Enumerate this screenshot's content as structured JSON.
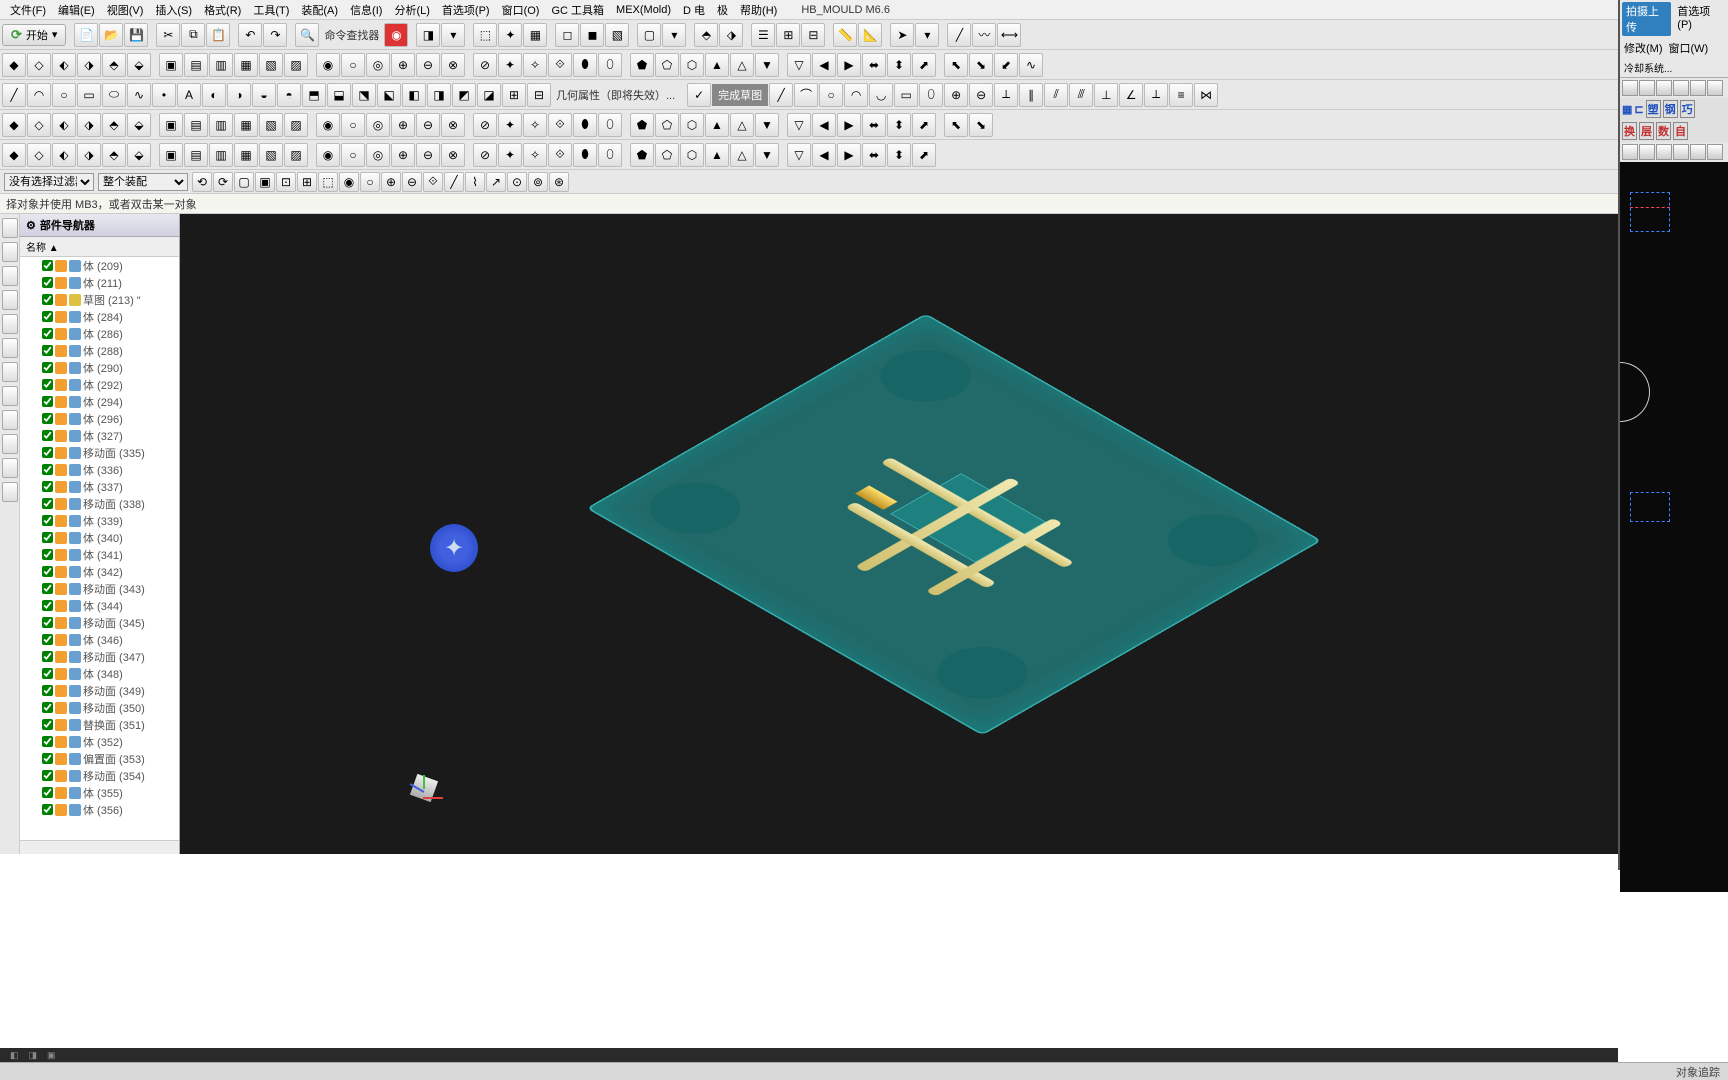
{
  "menubar": {
    "items": [
      "文件(F)",
      "编辑(E)",
      "视图(V)",
      "插入(S)",
      "格式(R)",
      "工具(T)",
      "装配(A)",
      "信息(I)",
      "分析(L)",
      "首选项(P)",
      "窗口(O)",
      "GC 工具箱",
      "MEX(Mold)",
      "D 电",
      "极",
      "帮助(H)"
    ],
    "title": "HB_MOULD M6.6"
  },
  "right_top": {
    "upload": "拍摄上传",
    "pref": "首选项(P)"
  },
  "right_menu": {
    "m1": "修改(M)",
    "m2": "窗口(W)"
  },
  "right_tab": "冷却系统...",
  "right_band": [
    "塑",
    "钢",
    "巧"
  ],
  "right_band2": [
    "换",
    "层",
    "数",
    "自"
  ],
  "start_btn": {
    "label": "开始"
  },
  "cmd_finder": "命令查找器",
  "geom_prop": "几何属性（即将失效）...",
  "complete_sketch": "完成草图",
  "selection": {
    "filter_label": "有选择过滤器",
    "filter_value": "没有选择过滤器",
    "scope_value": "整个装配"
  },
  "prompt": "择对象并使用 MB3，或者双击某一对象",
  "nav": {
    "title": "部件导航器",
    "col": "名称 ▲",
    "items": [
      {
        "t": "体",
        "n": "(209)"
      },
      {
        "t": "体",
        "n": "(211)"
      },
      {
        "t": "草图",
        "n": "(213) \"",
        "sketch": true
      },
      {
        "t": "体",
        "n": "(284)"
      },
      {
        "t": "体",
        "n": "(286)"
      },
      {
        "t": "体",
        "n": "(288)"
      },
      {
        "t": "体",
        "n": "(290)"
      },
      {
        "t": "体",
        "n": "(292)"
      },
      {
        "t": "体",
        "n": "(294)"
      },
      {
        "t": "体",
        "n": "(296)"
      },
      {
        "t": "体",
        "n": "(327)"
      },
      {
        "t": "移动面",
        "n": "(335)"
      },
      {
        "t": "体",
        "n": "(336)"
      },
      {
        "t": "体",
        "n": "(337)"
      },
      {
        "t": "移动面",
        "n": "(338)"
      },
      {
        "t": "体",
        "n": "(339)"
      },
      {
        "t": "体",
        "n": "(340)"
      },
      {
        "t": "体",
        "n": "(341)"
      },
      {
        "t": "体",
        "n": "(342)"
      },
      {
        "t": "移动面",
        "n": "(343)"
      },
      {
        "t": "体",
        "n": "(344)"
      },
      {
        "t": "移动面",
        "n": "(345)"
      },
      {
        "t": "体",
        "n": "(346)"
      },
      {
        "t": "移动面",
        "n": "(347)"
      },
      {
        "t": "体",
        "n": "(348)"
      },
      {
        "t": "移动面",
        "n": "(349)"
      },
      {
        "t": "移动面",
        "n": "(350)"
      },
      {
        "t": "替换面",
        "n": "(351)"
      },
      {
        "t": "体",
        "n": "(352)"
      },
      {
        "t": "偏置面",
        "n": "(353)"
      },
      {
        "t": "移动面",
        "n": "(354)"
      },
      {
        "t": "体",
        "n": "(355)"
      },
      {
        "t": "体",
        "n": "(356)"
      }
    ]
  },
  "status": {
    "left_items": [
      "",
      "",
      "",
      ""
    ],
    "right_items": [
      "对象追踪"
    ]
  },
  "toolbar_icons": {
    "count_row1": 44,
    "count_row2": 40,
    "count_row3": 48,
    "count_row4": 38,
    "count_row5": 36,
    "count_sel": 18
  }
}
